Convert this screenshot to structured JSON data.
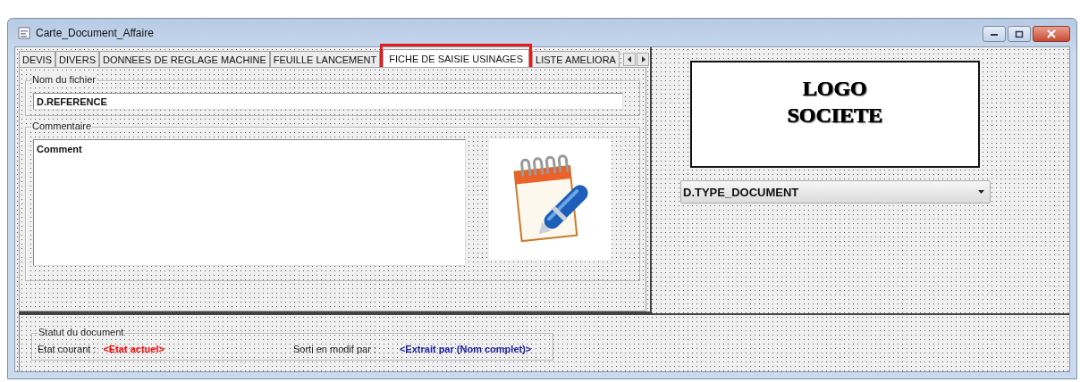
{
  "window": {
    "title": "Carte_Document_Affaire"
  },
  "tabs": [
    {
      "label": "DEVIS",
      "selected": false,
      "highlighted": false
    },
    {
      "label": "DIVERS",
      "selected": false,
      "highlighted": false
    },
    {
      "label": "DONNEES DE REGLAGE MACHINE",
      "selected": false,
      "highlighted": false
    },
    {
      "label": "FEUILLE LANCEMENT",
      "selected": false,
      "highlighted": false
    },
    {
      "label": "FICHE DE SAISIE USINAGES",
      "selected": true,
      "highlighted": true
    },
    {
      "label": "LISTE AMELIORA",
      "selected": false,
      "highlighted": false
    }
  ],
  "file_group": {
    "legend": "Nom du fichier",
    "value": "D.REFERENCE"
  },
  "comment_group": {
    "legend": "Commentaire",
    "value": "Comment"
  },
  "logo": {
    "lines": [
      "LOGO",
      "SOCIETE"
    ]
  },
  "document_type": {
    "value": "D.TYPE_DOCUMENT"
  },
  "status_group": {
    "legend": "Statut du document",
    "fields": [
      {
        "label": "Etat courant :",
        "value": "<Etat actuel>",
        "color": "#ff0000"
      },
      {
        "label": "Sorti en modif par :",
        "value": "<Extrait par (Nom complet)>",
        "color": "#1c1c9c"
      }
    ]
  }
}
